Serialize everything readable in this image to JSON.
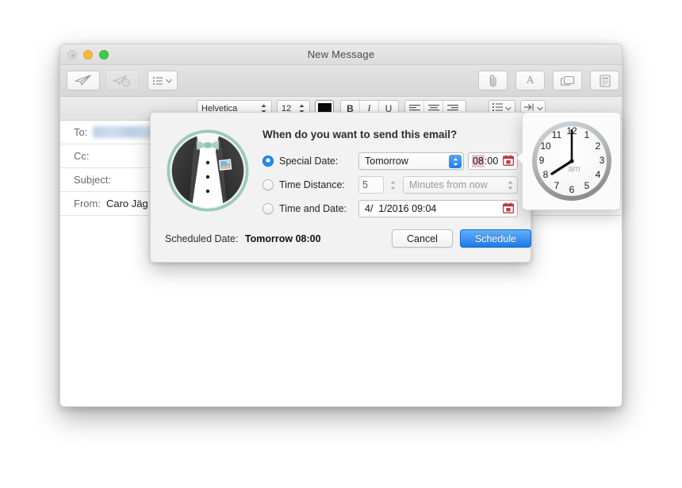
{
  "window": {
    "title": "New Message",
    "traffic_lights": [
      "close",
      "minimize",
      "zoom"
    ],
    "toolbar": {
      "send_label": "send-icon",
      "send_later_label": "send-later-icon",
      "header_fields_label": "header-fields-icon",
      "attach_label": "attachment-icon",
      "fonts_label": "fonts-icon",
      "photo_browser_label": "photo-browser-icon",
      "stationery_label": "stationery-icon"
    },
    "format_bar": {
      "font_family": "Helvetica",
      "font_size": "12",
      "color_hex": "#0b0b0b",
      "bold": "B",
      "italic": "I",
      "underline": "U",
      "align_left": "align-left-icon",
      "align_center": "align-center-icon",
      "align_right": "align-right-icon",
      "lists": "list-icon",
      "indent": "indent-icon"
    },
    "fields": [
      {
        "label": "To:",
        "value": "",
        "redacted": true
      },
      {
        "label": "Cc:",
        "value": "",
        "redacted": false
      },
      {
        "label": "Subject:",
        "value": "",
        "redacted": false
      },
      {
        "label": "From:",
        "value": "Caro Jäg",
        "redacted": false
      }
    ]
  },
  "dialog": {
    "question": "When do you want to send this email?",
    "icon": "tuxedo-icon",
    "options": [
      {
        "label": "Special Date:",
        "selected": true,
        "popup_value": "Tomorrow",
        "time_value_hour": "08",
        "time_value_rest": ":00",
        "calendar_icon": "calendar-icon"
      },
      {
        "label": "Time Distance:",
        "selected": false,
        "amount": "5",
        "unit_value": "Minutes from now"
      },
      {
        "label": "Time and Date:",
        "selected": false,
        "datetime_value": "4/  1/2016 09:04",
        "calendar_icon": "calendar-icon"
      }
    ],
    "scheduled_label": "Scheduled Date:",
    "scheduled_value": "Tomorrow 08:00",
    "cancel_label": "Cancel",
    "schedule_label": "Schedule",
    "accent_hex": "#2079e6",
    "highlight_hex": "#edc6cd"
  },
  "clock": {
    "hour_numerals": [
      "12",
      "1",
      "2",
      "3",
      "4",
      "5",
      "6",
      "7",
      "8",
      "9",
      "10",
      "11"
    ],
    "meridiem": "am",
    "hour_hand": "8",
    "minute_hand": "12",
    "display_time": "08:00"
  }
}
